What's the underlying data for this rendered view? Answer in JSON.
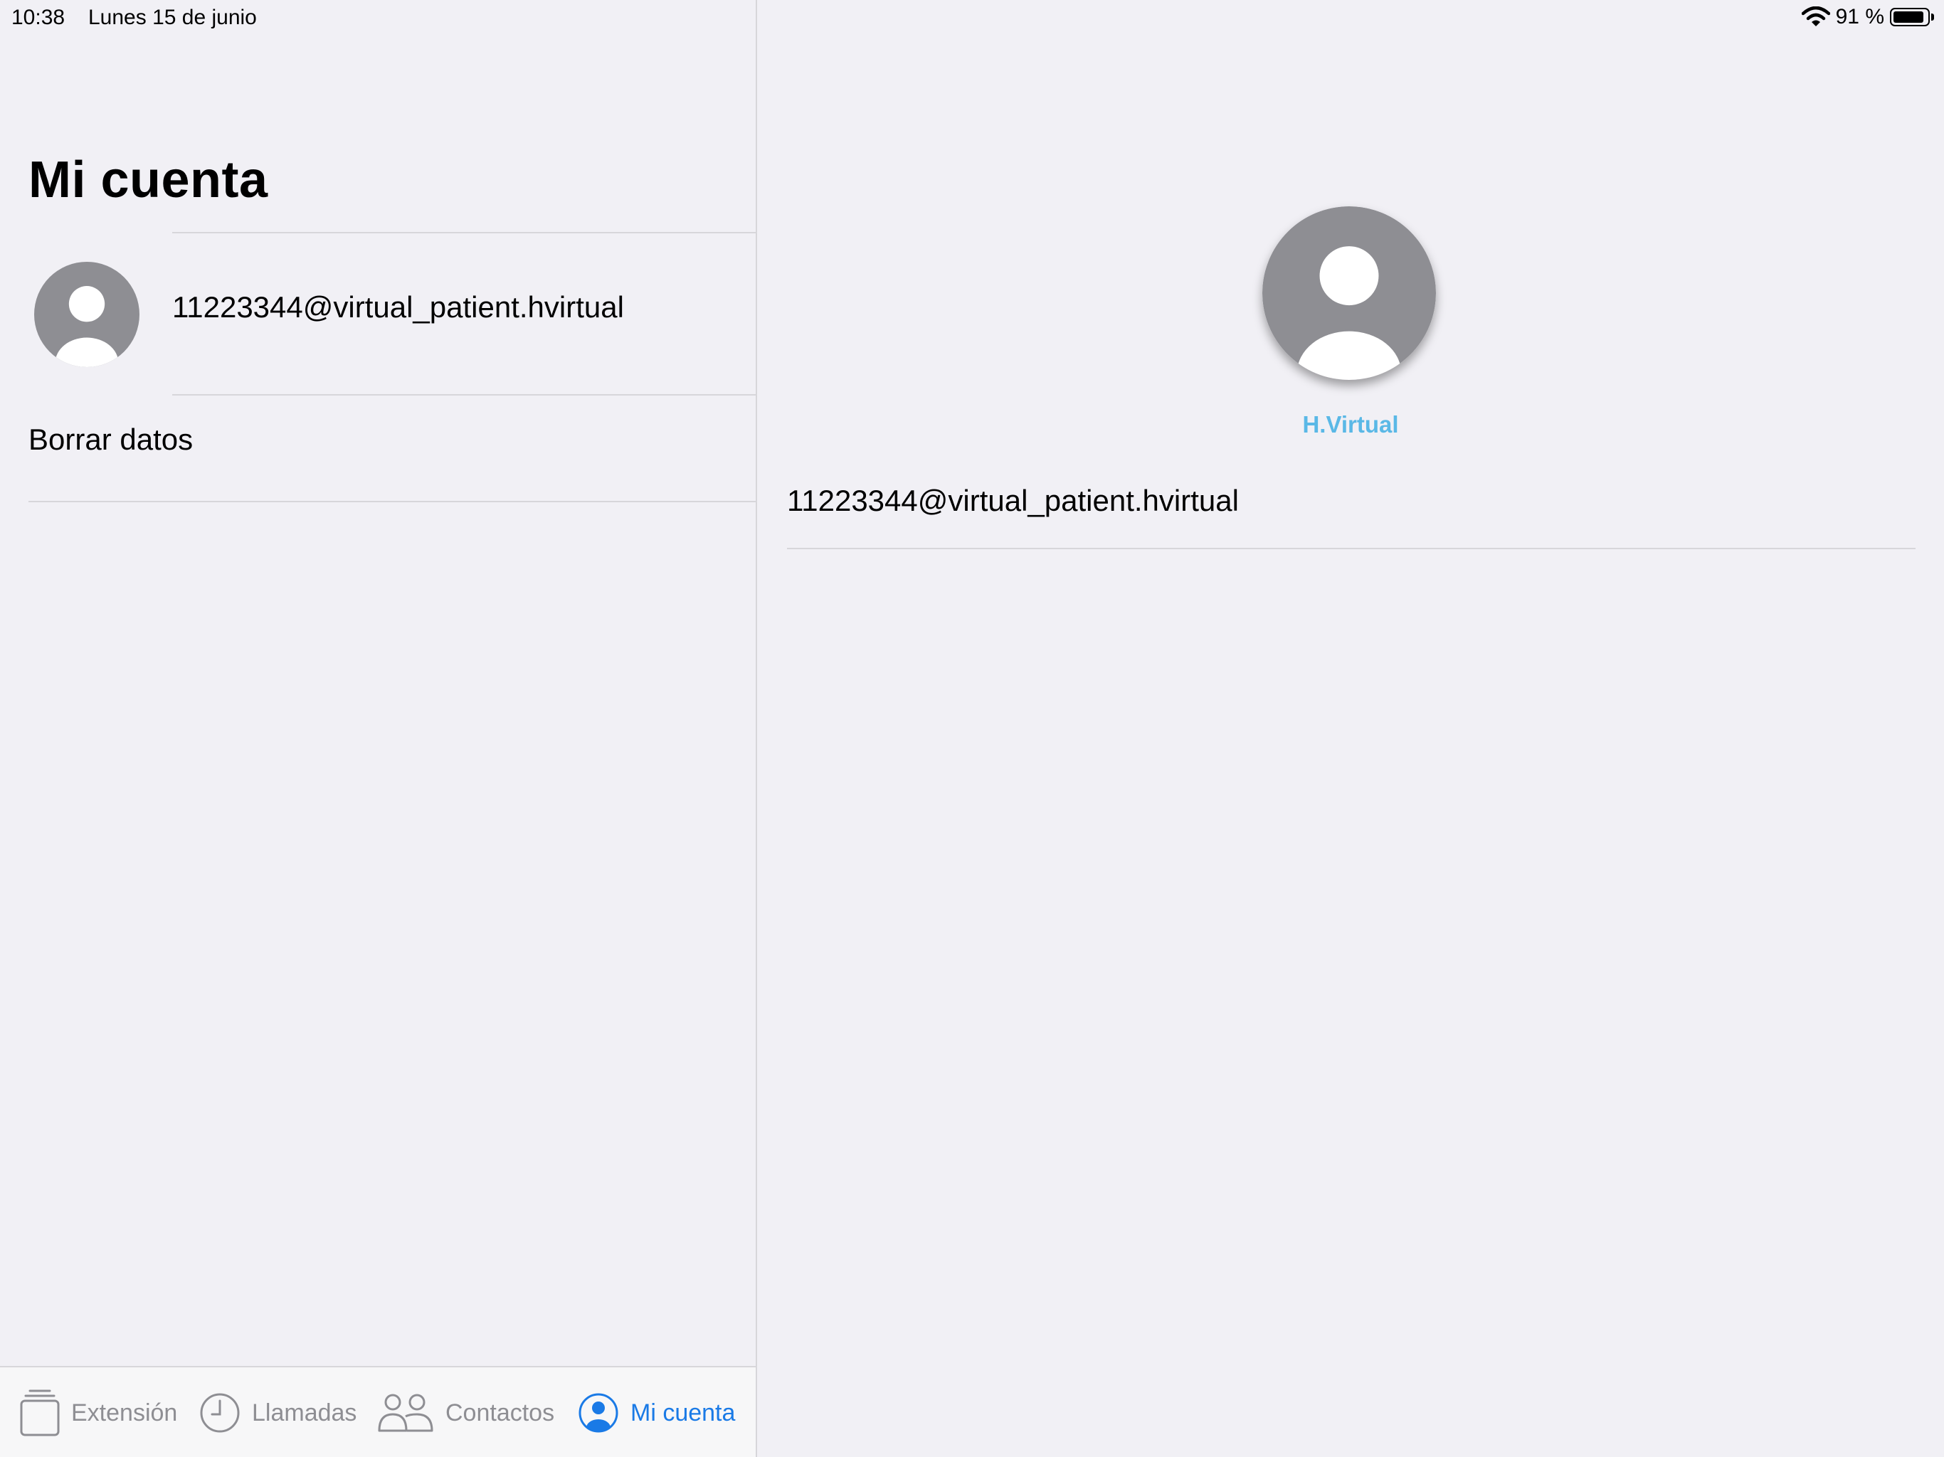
{
  "status_bar": {
    "time": "10:38",
    "date": "Lunes 15 de junio",
    "battery_text": "91 %",
    "battery_level": 0.91
  },
  "master": {
    "title": "Mi cuenta",
    "account_email": "11223344@virtual_patient.hvirtual",
    "delete_label": "Borrar datos"
  },
  "tab_bar": {
    "items": [
      {
        "label": "Extensión",
        "icon": "extension-icon",
        "active": false
      },
      {
        "label": "Llamadas",
        "icon": "clock-icon",
        "active": false
      },
      {
        "label": "Contactos",
        "icon": "contacts-icon",
        "active": false
      },
      {
        "label": "Mi cuenta",
        "icon": "person-circle-icon",
        "active": true
      }
    ]
  },
  "detail": {
    "name": "H.Virtual",
    "email": "11223344@virtual_patient.hvirtual"
  },
  "colors": {
    "accent": "#1a7ae6",
    "name_link": "#5ab8e6",
    "avatar_gray": "#8e8e93",
    "background": "#f1f0f5"
  }
}
